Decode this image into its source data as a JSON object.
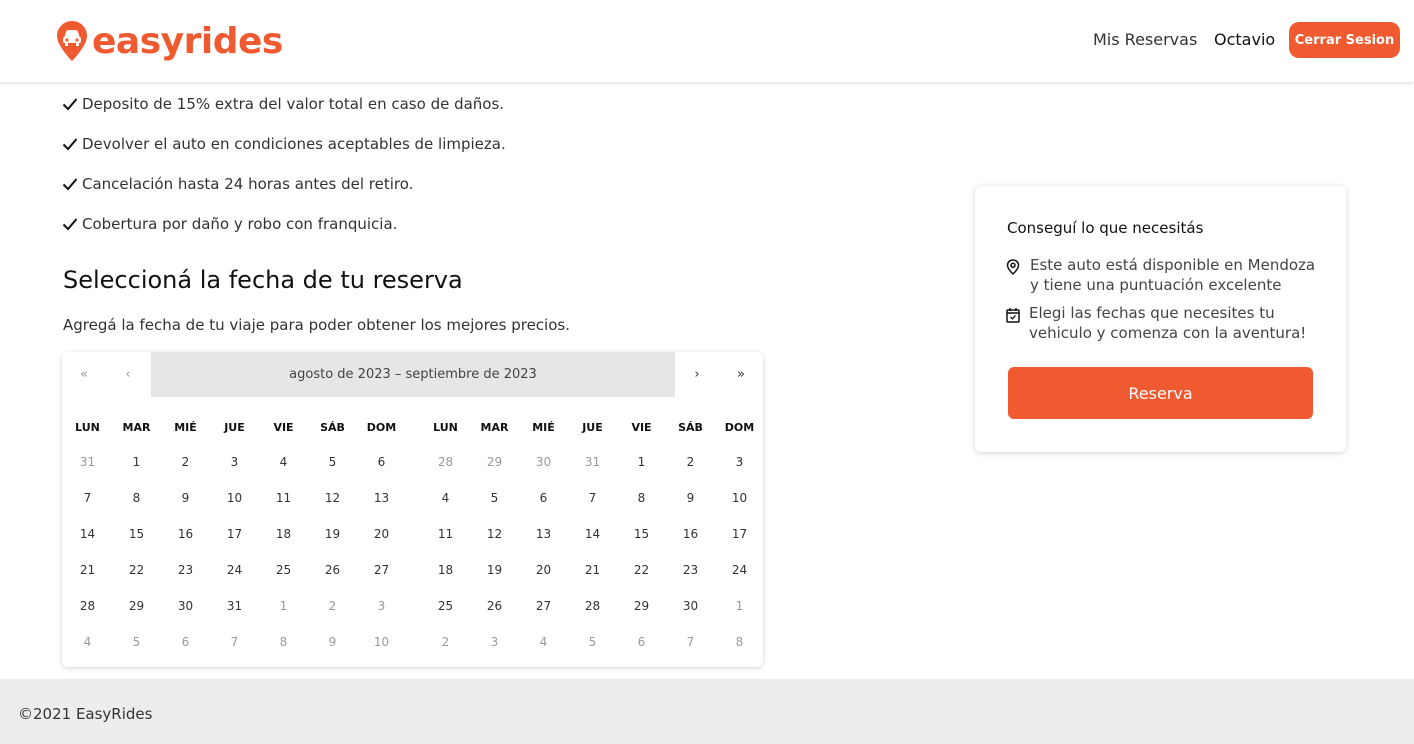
{
  "brand": {
    "name": "easyrides",
    "color": "#f05a30",
    "icon": "car-pin-icon"
  },
  "nav": {
    "reservas": "Mis Reservas",
    "user": "Octavio",
    "logout": "Cerrar Sesion"
  },
  "conditions": [
    "Deposito de 15% extra del valor total en caso de daños.",
    "Devolver el auto en condiciones aceptables de limpieza.",
    "Cancelación hasta 24 horas antes del retiro.",
    "Cobertura por daño y robo con franquicia."
  ],
  "date_section": {
    "title": "Seleccioná la fecha de tu reserva",
    "subtitle": "Agregá la fecha de tu viaje para poder obtener los mejores precios."
  },
  "calendar": {
    "nav": {
      "prev_year": "«",
      "prev": "‹",
      "next": "›",
      "next_year": "»"
    },
    "label": "agosto de 2023 – septiembre de 2023",
    "weekdays": [
      "LUN",
      "MAR",
      "MIÉ",
      "JUE",
      "VIE",
      "SÁB",
      "DOM"
    ],
    "months": [
      {
        "name": "agosto de 2023",
        "weeks": [
          [
            {
              "d": "31",
              "m": true
            },
            {
              "d": "1"
            },
            {
              "d": "2"
            },
            {
              "d": "3"
            },
            {
              "d": "4"
            },
            {
              "d": "5"
            },
            {
              "d": "6"
            }
          ],
          [
            {
              "d": "7"
            },
            {
              "d": "8"
            },
            {
              "d": "9"
            },
            {
              "d": "10"
            },
            {
              "d": "11"
            },
            {
              "d": "12"
            },
            {
              "d": "13"
            }
          ],
          [
            {
              "d": "14"
            },
            {
              "d": "15"
            },
            {
              "d": "16"
            },
            {
              "d": "17"
            },
            {
              "d": "18"
            },
            {
              "d": "19"
            },
            {
              "d": "20"
            }
          ],
          [
            {
              "d": "21"
            },
            {
              "d": "22"
            },
            {
              "d": "23"
            },
            {
              "d": "24"
            },
            {
              "d": "25"
            },
            {
              "d": "26"
            },
            {
              "d": "27"
            }
          ],
          [
            {
              "d": "28"
            },
            {
              "d": "29"
            },
            {
              "d": "30"
            },
            {
              "d": "31"
            },
            {
              "d": "1",
              "m": true
            },
            {
              "d": "2",
              "m": true
            },
            {
              "d": "3",
              "m": true
            }
          ],
          [
            {
              "d": "4",
              "m": true
            },
            {
              "d": "5",
              "m": true
            },
            {
              "d": "6",
              "m": true
            },
            {
              "d": "7",
              "m": true
            },
            {
              "d": "8",
              "m": true
            },
            {
              "d": "9",
              "m": true
            },
            {
              "d": "10",
              "m": true
            }
          ]
        ]
      },
      {
        "name": "septiembre de 2023",
        "weeks": [
          [
            {
              "d": "28",
              "m": true
            },
            {
              "d": "29",
              "m": true
            },
            {
              "d": "30",
              "m": true
            },
            {
              "d": "31",
              "m": true
            },
            {
              "d": "1"
            },
            {
              "d": "2"
            },
            {
              "d": "3"
            }
          ],
          [
            {
              "d": "4"
            },
            {
              "d": "5"
            },
            {
              "d": "6"
            },
            {
              "d": "7"
            },
            {
              "d": "8"
            },
            {
              "d": "9"
            },
            {
              "d": "10"
            }
          ],
          [
            {
              "d": "11"
            },
            {
              "d": "12"
            },
            {
              "d": "13"
            },
            {
              "d": "14"
            },
            {
              "d": "15"
            },
            {
              "d": "16"
            },
            {
              "d": "17"
            }
          ],
          [
            {
              "d": "18"
            },
            {
              "d": "19"
            },
            {
              "d": "20"
            },
            {
              "d": "21"
            },
            {
              "d": "22"
            },
            {
              "d": "23"
            },
            {
              "d": "24"
            }
          ],
          [
            {
              "d": "25"
            },
            {
              "d": "26"
            },
            {
              "d": "27"
            },
            {
              "d": "28"
            },
            {
              "d": "29"
            },
            {
              "d": "30"
            },
            {
              "d": "1",
              "m": true
            }
          ],
          [
            {
              "d": "2",
              "m": true
            },
            {
              "d": "3",
              "m": true
            },
            {
              "d": "4",
              "m": true
            },
            {
              "d": "5",
              "m": true
            },
            {
              "d": "6",
              "m": true
            },
            {
              "d": "7",
              "m": true
            },
            {
              "d": "8",
              "m": true
            }
          ]
        ]
      }
    ]
  },
  "card": {
    "title": "Conseguí lo que necesitás",
    "location_line1": "Este auto está disponible en Mendoza",
    "location_line2": "y tiene una puntuación excelente",
    "dates_line1": "Elegi las fechas que necesites tu",
    "dates_line2": "vehiculo y comenza con la aventura!",
    "button": "Reserva"
  },
  "footer": {
    "text": "©2021 EasyRides"
  }
}
